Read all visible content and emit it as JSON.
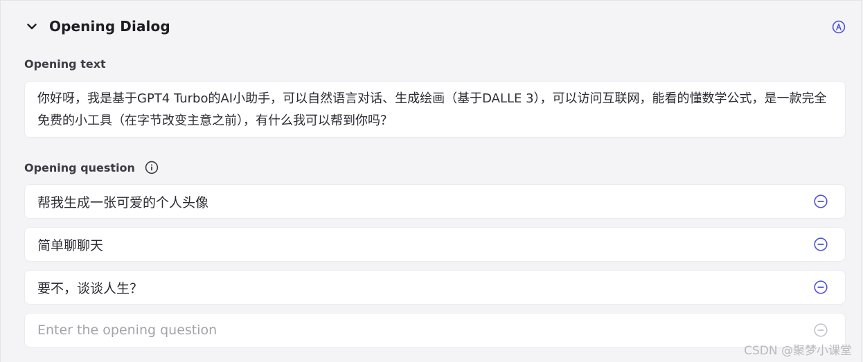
{
  "section": {
    "title": "Opening Dialog",
    "collapse_icon": "chevron-down-icon",
    "auto_icon": "circle-a-icon"
  },
  "opening_text": {
    "label": "Opening text",
    "value": "你好呀，我是基于GPT4 Turbo的AI小助手，可以自然语言对话、生成绘画（基于DALLE 3），可以访问互联网，能看的懂数学公式，是一款完全免费的小工具（在字节改变主意之前），有什么我可以帮到你吗？"
  },
  "opening_question": {
    "label": "Opening question",
    "info_icon": "info-icon",
    "items": [
      {
        "text": "帮我生成一张可爱的个人头像"
      },
      {
        "text": "简单聊聊天"
      },
      {
        "text": "要不，谈谈人生？"
      }
    ],
    "input_placeholder": "Enter the opening question",
    "input_value": ""
  },
  "colors": {
    "accent": "#4e52d6",
    "disabled": "#c3c4ca",
    "background": "#f4f4f6"
  },
  "watermark": "CSDN @聚梦小课堂"
}
